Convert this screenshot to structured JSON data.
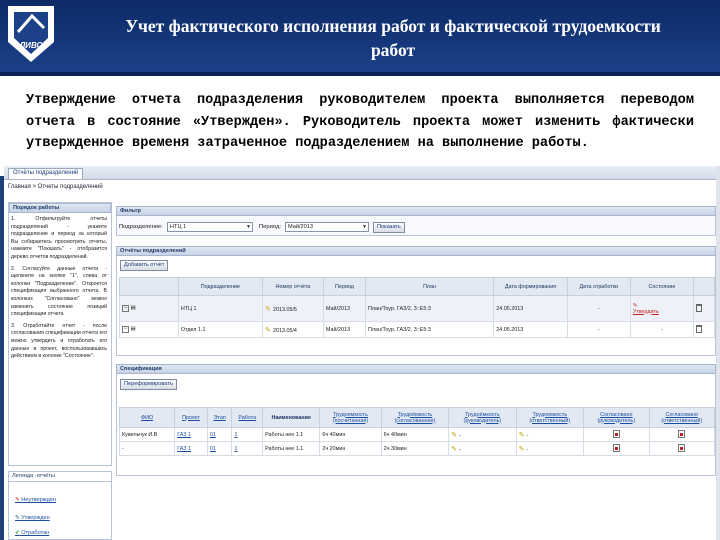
{
  "slide": {
    "title_line1": "Учет фактического исполнения работ и фактической трудоемкости",
    "title_line2": "работ",
    "description": "Утверждение отчета подразделения руководителем проекта выполняется переводом отчета в состояние «Утвержден». Руководитель проекта может изменить фактически утвержденное временя затраченное подразделением на выполнение работы.",
    "logo_text": "ЛИВС"
  },
  "app": {
    "tab_label": "Отчёты подразделений",
    "breadcrumb": "Главная > Отчеты подразделений",
    "left_panel": {
      "title": "Порядок работы",
      "steps": [
        "1. Отфильтруйте отчеты подразделений - укажите подразделение и период за который Вы собираетесь просмотреть отчеты, нажмите \"Показать\" - отобразится дерево отчетов подразделений.",
        "2. Согласуйте данные отчета - щелкните на кнопке \"1\", слева от колонки \"Подразделение\". Откроется спецификация выбранного отчета. В колонках \"Согласовано\" можно изменить состояние позиций спецификации отчета",
        "3. Отработайте отчет - после согласования спецификации отчета его можно утвердить и отработать его данные в проект, воспользовавшись действием в колонке \"Состояние\"."
      ]
    },
    "legend": {
      "title": "Легенда -отчёты",
      "items": [
        "Неутвержден",
        "Утвержден",
        "Отработан"
      ]
    },
    "filter": {
      "title": "Фильтр",
      "division_label": "Подразделение:",
      "division_value": "НТЦ 1",
      "period_label": "Период:",
      "period_value": "Май/2013",
      "show_button": "Показать"
    },
    "reports": {
      "title": "Отчёты подразделений",
      "add_button": "Добавить отчёт",
      "columns": [
        "Подразделение",
        "Номер отчёта",
        "Период",
        "План",
        "Дата формирования",
        "Дата отработки",
        "Состояние"
      ],
      "rows": [
        {
          "division": "НТЦ 1",
          "number": "2013.05/5",
          "period": "Май/2013",
          "plan": "План/Тоур. ГАЗ/2, 3::Е5:3",
          "date_formed": "24.05.2013",
          "date_processed": "-",
          "state_action": "Утвердить"
        },
        {
          "division": "Отдел 1.1",
          "number": "2013.05/4",
          "period": "Май/2013",
          "plan": "План/Тоур. ГАЗ/2, 3::Е5:3",
          "date_formed": "24.05.2013",
          "date_processed": "-",
          "state_action": "-"
        }
      ]
    },
    "spec": {
      "title": "Спецификация",
      "form_button": "Переформировать",
      "columns": [
        "ФИО",
        "Проект",
        "Этап",
        "Работа",
        "Наименование",
        "Трудоемкость (посчитанная)",
        "Трудоёмкость (согласованная)",
        "Трудоёмкость (руководитель)",
        "Трудоемкость (ответственный)",
        "Согласовано (руководитель)",
        "Согласовано (ответственный)"
      ],
      "rows": [
        {
          "fio": "Кувельчук И.В",
          "project": "ГАЗ 1",
          "stage": "01",
          "work": "1",
          "name": "Работы нее 1.1",
          "t_calc": "6ч 40мин",
          "t_agreed": "6ч 40мин",
          "t_head": "-",
          "t_resp": "-"
        },
        {
          "fio": "-",
          "project": "ГАЗ 1",
          "stage": "01",
          "work": "1",
          "name": "Работы нее 1.1",
          "t_calc": "2ч 20мин",
          "t_agreed": "2ч 30мин",
          "t_head": "-",
          "t_resp": "-"
        }
      ]
    }
  }
}
